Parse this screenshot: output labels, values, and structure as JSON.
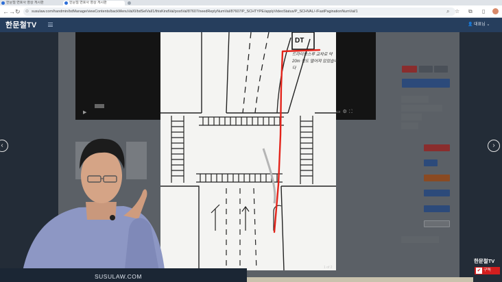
{
  "browser": {
    "tabs": [
      {
        "title": "한문철 변호사 영상 게시판"
      },
      {
        "title": "한문철 변호사 영상 게시판"
      },
      {
        "title": ""
      }
    ],
    "url": "susulaw.com/handmin/bdManage/viewContents/backMenuVal/0/bdSelVal/1/thisKindVal/postVal/87607/needReplyNumVal/87607/P_SCHTYPE/applyVideoStatus/P_SCHVAL/-/FastPaginationNumVal/1"
  },
  "site": {
    "logo": "한문철TV",
    "user_menu": "대표님 ⌄"
  },
  "drawing": {
    "dt_label": "DT",
    "note": "드라이브스루 교차로 약 20m 정도 떨어져 있었습니다",
    "page_indicator": "1 of 2"
  },
  "caption": {
    "text": "SUSULAW.COM"
  },
  "channel": {
    "watermark": "한문철TV",
    "subscribe_label": "구독"
  },
  "colors": {
    "brand_header": "#263e5d",
    "route_line": "#e3241b",
    "subscribe": "#d21e1e"
  }
}
